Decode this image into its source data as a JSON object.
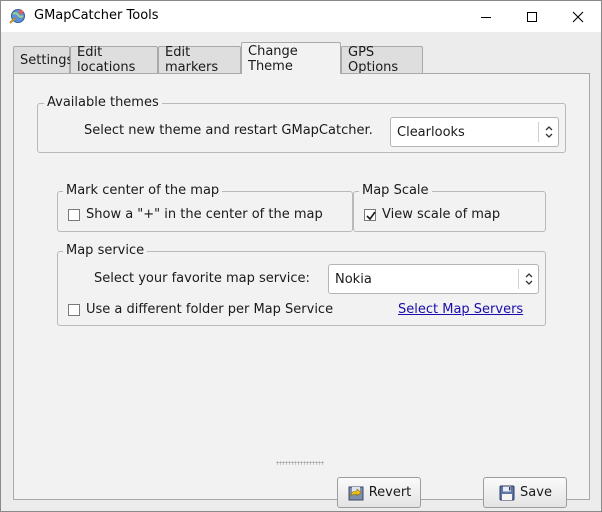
{
  "window": {
    "title": "GMapCatcher Tools",
    "controls": [
      "minimize-icon",
      "maximize-icon",
      "close-icon"
    ]
  },
  "tabs": [
    {
      "label": "Settings",
      "active": false
    },
    {
      "label": "Edit locations",
      "active": false
    },
    {
      "label": "Edit markers",
      "active": false
    },
    {
      "label": "Change Theme",
      "active": true
    },
    {
      "label": "GPS Options",
      "active": false
    }
  ],
  "themes": {
    "legend": "Available themes",
    "prompt": "Select new theme and restart GMapCatcher.",
    "selected": "Clearlooks"
  },
  "center_mark": {
    "legend": "Mark center of the map",
    "checkbox_label": "Show a \"+\" in the center of the map",
    "checked": false
  },
  "map_scale": {
    "legend": "Map Scale",
    "checkbox_label": "View scale of map",
    "checked": true
  },
  "map_service": {
    "legend": "Map service",
    "prompt": "Select your favorite map service:",
    "selected": "Nokia",
    "folder_checkbox_label": "Use a different folder per Map Service",
    "folder_checked": false,
    "servers_link": "Select Map Servers"
  },
  "buttons": {
    "revert": "Revert",
    "save": "Save"
  },
  "colors": {
    "panel_bg": "#f2f2f2",
    "link": "#1a0dab"
  }
}
